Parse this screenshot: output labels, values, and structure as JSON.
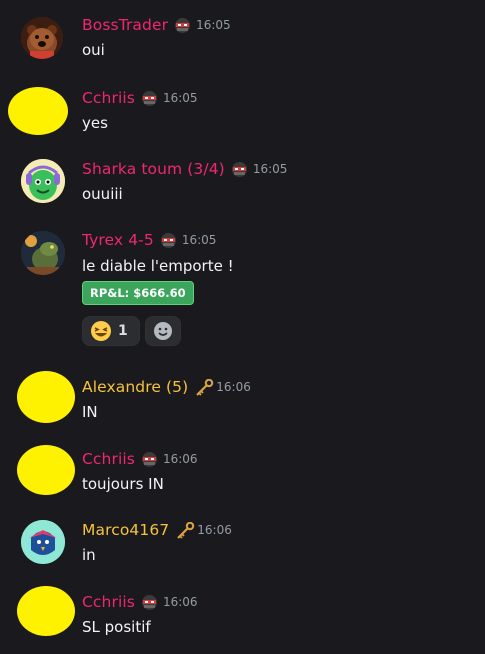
{
  "messages": [
    {
      "username": "BossTrader",
      "time": "16:05",
      "text": "oui",
      "name_color": "#f0266f",
      "role_icon": "ninja-role-icon"
    },
    {
      "username": "Cchriis",
      "time": "16:05",
      "text": "yes",
      "name_color": "#f0266f",
      "role_icon": "ninja-role-icon"
    },
    {
      "username": "Sharka toum (3/4)",
      "time": "16:05",
      "text": "ouuiii",
      "name_color": "#f0266f",
      "role_icon": "ninja-role-icon"
    },
    {
      "username": "Tyrex 4-5",
      "time": "16:05",
      "text": "le diable l'emporte !",
      "name_color": "#f0266f",
      "role_icon": "ninja-role-icon",
      "badge": "RP&L: $666.60",
      "reactions": [
        {
          "emoji": "laughing-face",
          "count": "1"
        }
      ]
    },
    {
      "username": "Alexandre (5)",
      "time": "16:06",
      "text": "IN",
      "name_color": "#f5c33b",
      "role_icon": "key-role-icon"
    },
    {
      "username": "Cchriis",
      "time": "16:06",
      "text": "toujours IN",
      "name_color": "#f0266f",
      "role_icon": "ninja-role-icon"
    },
    {
      "username": "Marco4167",
      "time": "16:06",
      "text": "in",
      "name_color": "#f5c33b",
      "role_icon": "key-role-icon"
    },
    {
      "username": "Cchriis",
      "time": "16:06",
      "text": "SL positif",
      "name_color": "#f0266f",
      "role_icon": "ninja-role-icon"
    }
  ]
}
